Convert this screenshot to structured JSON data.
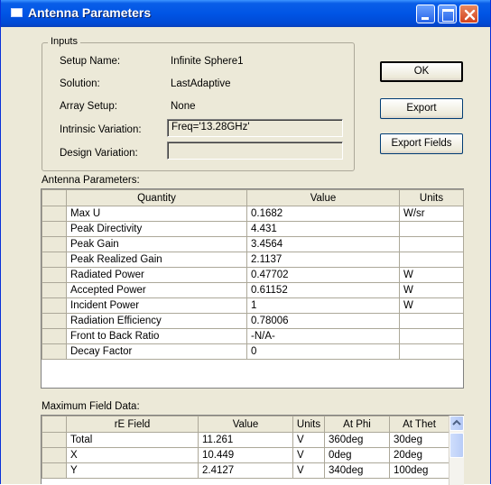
{
  "window": {
    "title": "Antenna Parameters"
  },
  "inputs": {
    "legend": "Inputs",
    "setup_name_label": "Setup Name:",
    "setup_name_value": "Infinite Sphere1",
    "solution_label": "Solution:",
    "solution_value": "LastAdaptive",
    "array_setup_label": "Array Setup:",
    "array_setup_value": "None",
    "intrinsic_variation_label": "Intrinsic Variation:",
    "intrinsic_variation_value": "Freq='13.28GHz'",
    "design_variation_label": "Design Variation:",
    "design_variation_value": ""
  },
  "buttons": {
    "ok": "OK",
    "export": "Export",
    "export_fields": "Export Fields"
  },
  "antenna_parameters": {
    "label": "Antenna Parameters:",
    "headers": [
      "Quantity",
      "Value",
      "Units"
    ],
    "rows": [
      {
        "quantity": "Max U",
        "value": "0.1682",
        "units": "W/sr"
      },
      {
        "quantity": "Peak Directivity",
        "value": "4.431",
        "units": ""
      },
      {
        "quantity": "Peak Gain",
        "value": "3.4564",
        "units": ""
      },
      {
        "quantity": "Peak Realized Gain",
        "value": "2.1137",
        "units": ""
      },
      {
        "quantity": "Radiated Power",
        "value": "0.47702",
        "units": "W"
      },
      {
        "quantity": "Accepted Power",
        "value": "0.61152",
        "units": "W"
      },
      {
        "quantity": "Incident Power",
        "value": "1",
        "units": "W"
      },
      {
        "quantity": "Radiation Efficiency",
        "value": "0.78006",
        "units": ""
      },
      {
        "quantity": "Front to Back Ratio",
        "value": "-N/A-",
        "units": ""
      },
      {
        "quantity": "Decay Factor",
        "value": "0",
        "units": ""
      }
    ]
  },
  "max_field_data": {
    "label": "Maximum Field Data:",
    "headers": [
      "rE Field",
      "Value",
      "Units",
      "At Phi",
      "At Thet"
    ],
    "rows": [
      {
        "field": "Total",
        "value": "11.261",
        "units": "V",
        "phi": "360deg",
        "theta": "30deg"
      },
      {
        "field": "X",
        "value": "10.449",
        "units": "V",
        "phi": "0deg",
        "theta": "20deg"
      },
      {
        "field": "Y",
        "value": "2.4127",
        "units": "V",
        "phi": "340deg",
        "theta": "100deg"
      }
    ]
  }
}
